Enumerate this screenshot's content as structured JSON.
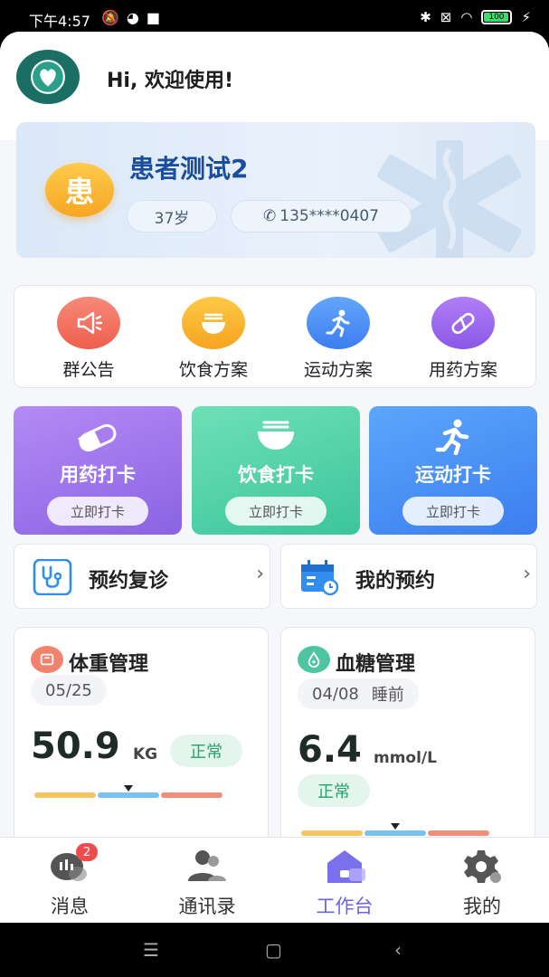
{
  "status_bar": {
    "time": "下午4:57",
    "battery": "100"
  },
  "header": {
    "greeting": "Hi, 欢迎使用!"
  },
  "profile": {
    "avatar_char": "患",
    "name": "患者测试2",
    "age": "37岁",
    "phone": "135****0407"
  },
  "quick_menu": [
    {
      "label": "群公告",
      "icon": "megaphone-icon",
      "color": "#f06f5a"
    },
    {
      "label": "饮食方案",
      "icon": "bowl-icon",
      "color": "#f7b52c"
    },
    {
      "label": "运动方案",
      "icon": "running-icon",
      "color": "#4a8ef5"
    },
    {
      "label": "用药方案",
      "icon": "pill-icon",
      "color": "#9c66ee"
    }
  ],
  "checkin": [
    {
      "title": "用药打卡",
      "button": "立即打卡"
    },
    {
      "title": "饮食打卡",
      "button": "立即打卡"
    },
    {
      "title": "运动打卡",
      "button": "立即打卡"
    }
  ],
  "appointments": {
    "followup": "预约复诊",
    "mine": "我的预约"
  },
  "weight": {
    "title": "体重管理",
    "date": "05/25",
    "value": "50.9",
    "unit": "KG",
    "status": "正常",
    "indicator_position": 0.5
  },
  "sugar": {
    "title": "血糖管理",
    "date": "04/08",
    "period": "睡前",
    "value": "6.4",
    "unit": "mmol/L",
    "status": "正常",
    "indicator_position": 0.5
  },
  "tabs": [
    {
      "label": "消息",
      "badge": "2"
    },
    {
      "label": "通讯录"
    },
    {
      "label": "工作台"
    },
    {
      "label": "我的"
    }
  ],
  "colors": {
    "accent": "#6b63e8",
    "primary_blue": "#1a4e9c",
    "normal_green": "#26a074"
  }
}
